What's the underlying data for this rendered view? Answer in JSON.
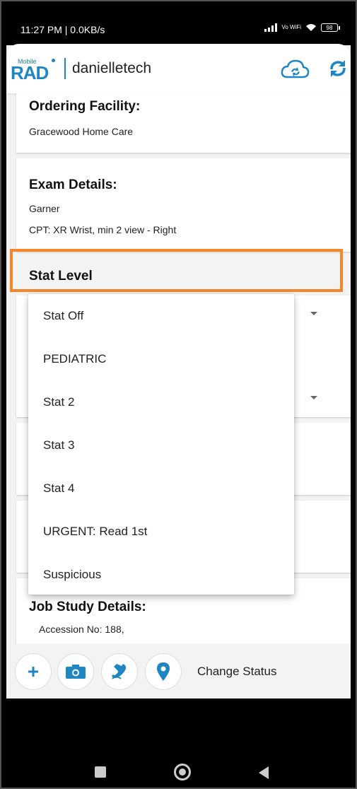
{
  "status_bar": {
    "time": "11:27 PM | 0.0KB/s",
    "network_label": "Vo WiFi",
    "battery": "98"
  },
  "app_bar": {
    "logo_small": "Mobile",
    "logo_big": "RAD",
    "username": "danielletech",
    "icons": [
      "cloud-sync-icon",
      "refresh-icon"
    ],
    "accent": "#1f86c4"
  },
  "ordering_facility": {
    "title": "Ordering Facility:",
    "value": "Gracewood Home Care"
  },
  "exam_details": {
    "title": "Exam Details:",
    "line1": "Garner",
    "line2": "CPT: XR Wrist, min 2 view - Right"
  },
  "stat_level": {
    "label": "Stat Level",
    "highlight_color": "#f7852a"
  },
  "dropdown": {
    "options": [
      "Stat Off",
      "PEDIATRIC",
      "Stat 2",
      "Stat 3",
      "Stat 4",
      "URGENT: Read 1st",
      "Suspicious"
    ]
  },
  "job_study": {
    "title": "Job Study Details:",
    "accession": "Accession No: 188,"
  },
  "action_bar": {
    "buttons": [
      "add-icon",
      "camera-icon",
      "phone-icon",
      "location-pin-icon"
    ],
    "change_status": "Change Status"
  }
}
